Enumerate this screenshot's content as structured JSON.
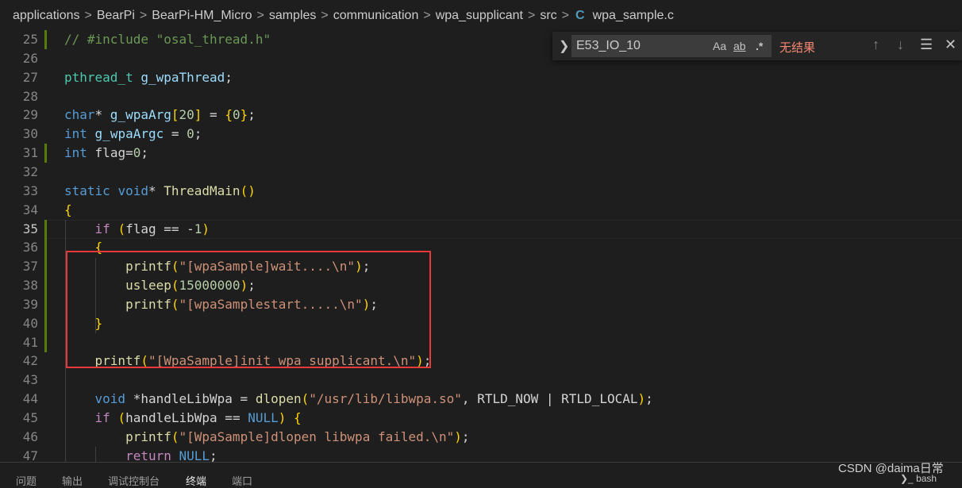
{
  "breadcrumb": {
    "items": [
      "applications",
      "BearPi",
      "BearPi-HM_Micro",
      "samples",
      "communication",
      "wpa_supplicant",
      "src"
    ],
    "separator": ">",
    "file_icon": "C",
    "file": "wpa_sample.c"
  },
  "editor": {
    "lines": [
      {
        "n": "25",
        "code": "// #include \"osal_thread.h\""
      },
      {
        "n": "26",
        "code": ""
      },
      {
        "n": "27",
        "code": "pthread_t g_wpaThread;"
      },
      {
        "n": "28",
        "code": ""
      },
      {
        "n": "29",
        "code": "char* g_wpaArg[20] = {0};"
      },
      {
        "n": "30",
        "code": "int g_wpaArgc = 0;"
      },
      {
        "n": "31",
        "code": "int flag=0;"
      },
      {
        "n": "32",
        "code": ""
      },
      {
        "n": "33",
        "code": "static void* ThreadMain()"
      },
      {
        "n": "34",
        "code": "{"
      },
      {
        "n": "35",
        "code": "    if (flag == -1)"
      },
      {
        "n": "36",
        "code": "    {"
      },
      {
        "n": "37",
        "code": "        printf(\"[wpaSample]wait....\\n\");"
      },
      {
        "n": "38",
        "code": "        usleep(15000000);"
      },
      {
        "n": "39",
        "code": "        printf(\"[wpaSamplestart.....\\n\");"
      },
      {
        "n": "40",
        "code": "    }"
      },
      {
        "n": "41",
        "code": ""
      },
      {
        "n": "42",
        "code": "    printf(\"[WpaSample]init wpa_supplicant.\\n\");"
      },
      {
        "n": "43",
        "code": ""
      },
      {
        "n": "44",
        "code": "    void *handleLibWpa = dlopen(\"/usr/lib/libwpa.so\", RTLD_NOW | RTLD_LOCAL);"
      },
      {
        "n": "45",
        "code": "    if (handleLibWpa == NULL) {"
      },
      {
        "n": "46",
        "code": "        printf(\"[WpaSample]dlopen libwpa failed.\\n\");"
      },
      {
        "n": "47",
        "code": "        return NULL;"
      }
    ],
    "active_line": "35"
  },
  "find": {
    "toggle_icon": "chevron-right-icon",
    "value": "E53_IO_10",
    "match_case_label": "Aa",
    "whole_word_label": "ab",
    "regex_label": ".*",
    "status": "无结果"
  },
  "panel": {
    "tabs": [
      "问题",
      "输出",
      "调试控制台",
      "终端",
      "端口"
    ],
    "active_tab": "终端",
    "terminal_label": "bash"
  },
  "watermark": "CSDN @daima日常",
  "colors": {
    "highlight_box": "#e8393a",
    "no_result": "#f48771",
    "modified_gutter": "#587c0c"
  }
}
